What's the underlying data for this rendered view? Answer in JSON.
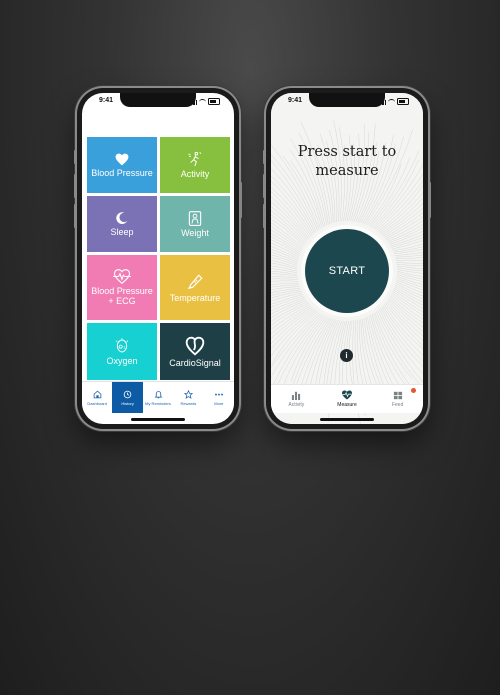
{
  "status": {
    "time": "9:41"
  },
  "left_phone": {
    "tiles": [
      {
        "label": "Blood Pressure",
        "color": "#3aa0db",
        "icon": "heart-icon"
      },
      {
        "label": "Activity",
        "color": "#87c03f",
        "icon": "activity-icon"
      },
      {
        "label": "Sleep",
        "color": "#7b71b5",
        "icon": "moon-icon"
      },
      {
        "label": "Weight",
        "color": "#6fb5ab",
        "icon": "scale-icon"
      },
      {
        "label": "Blood Pressure + ECG",
        "color": "#f07cb3",
        "icon": "heart-ecg-icon"
      },
      {
        "label": "Temperature",
        "color": "#eac043",
        "icon": "thermometer-icon"
      },
      {
        "label": "Oxygen",
        "color": "#17d0d1",
        "icon": "oxygen-icon"
      },
      {
        "label": "CardioSignal",
        "color": "#1d3f45",
        "icon": "cardiosignal-logo-icon"
      }
    ],
    "tabs": [
      {
        "label": "Dashboard",
        "icon": "home-icon"
      },
      {
        "label": "History",
        "icon": "clock-icon",
        "active": true
      },
      {
        "label": "My Reminders",
        "icon": "bell-icon"
      },
      {
        "label": "Rewards",
        "icon": "star-icon"
      },
      {
        "label": "More",
        "icon": "more-icon"
      }
    ]
  },
  "right_phone": {
    "title_line1": "Press start to",
    "title_line2": "measure",
    "start_label": "START",
    "info_label": "i",
    "tabs": [
      {
        "label": "Activity",
        "icon": "bar-chart-icon"
      },
      {
        "label": "Measure",
        "icon": "heart-pulse-icon",
        "active": true
      },
      {
        "label": "Feed",
        "icon": "feed-icon"
      }
    ]
  },
  "colors": {
    "accent_blue": "#0d5ba4",
    "start_teal": "#1d474e",
    "badge_orange": "#e6562f"
  }
}
